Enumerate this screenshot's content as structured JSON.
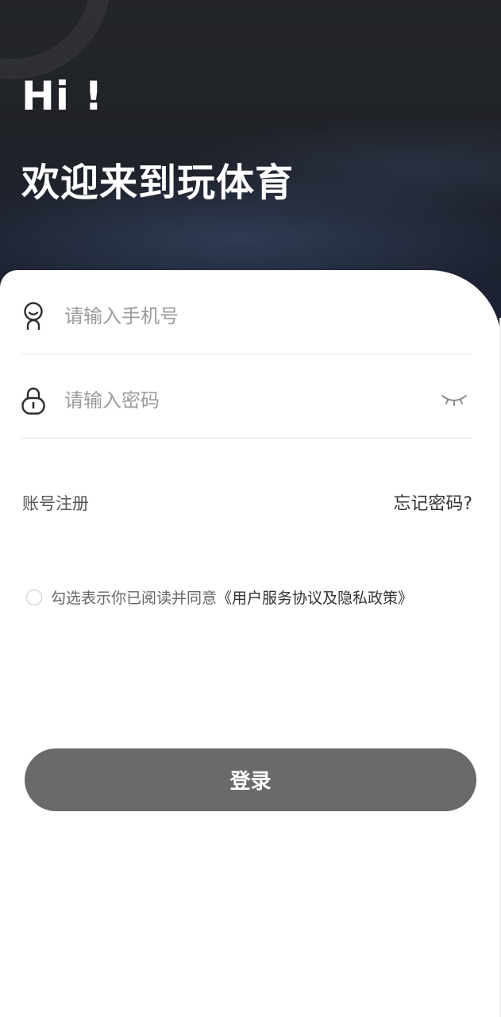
{
  "header": {
    "greeting": "Hi !",
    "welcome": "欢迎来到玩体育"
  },
  "form": {
    "phone": {
      "placeholder": "请输入手机号",
      "value": "",
      "icon": "user-icon"
    },
    "password": {
      "placeholder": "请输入密码",
      "value": "",
      "icon": "lock-icon",
      "toggle_icon": "eye-closed-icon"
    }
  },
  "links": {
    "register": "账号注册",
    "forgot": "忘记密码?"
  },
  "agreement": {
    "checked": false,
    "text": "勾选表示你已阅读并同意",
    "policy": "《用户服务协议及隐私政策》"
  },
  "login": {
    "label": "登录"
  },
  "colors": {
    "header_bg": "#1f2227",
    "button_bg": "#6a6a6a",
    "divider": "#e6e6e6"
  }
}
